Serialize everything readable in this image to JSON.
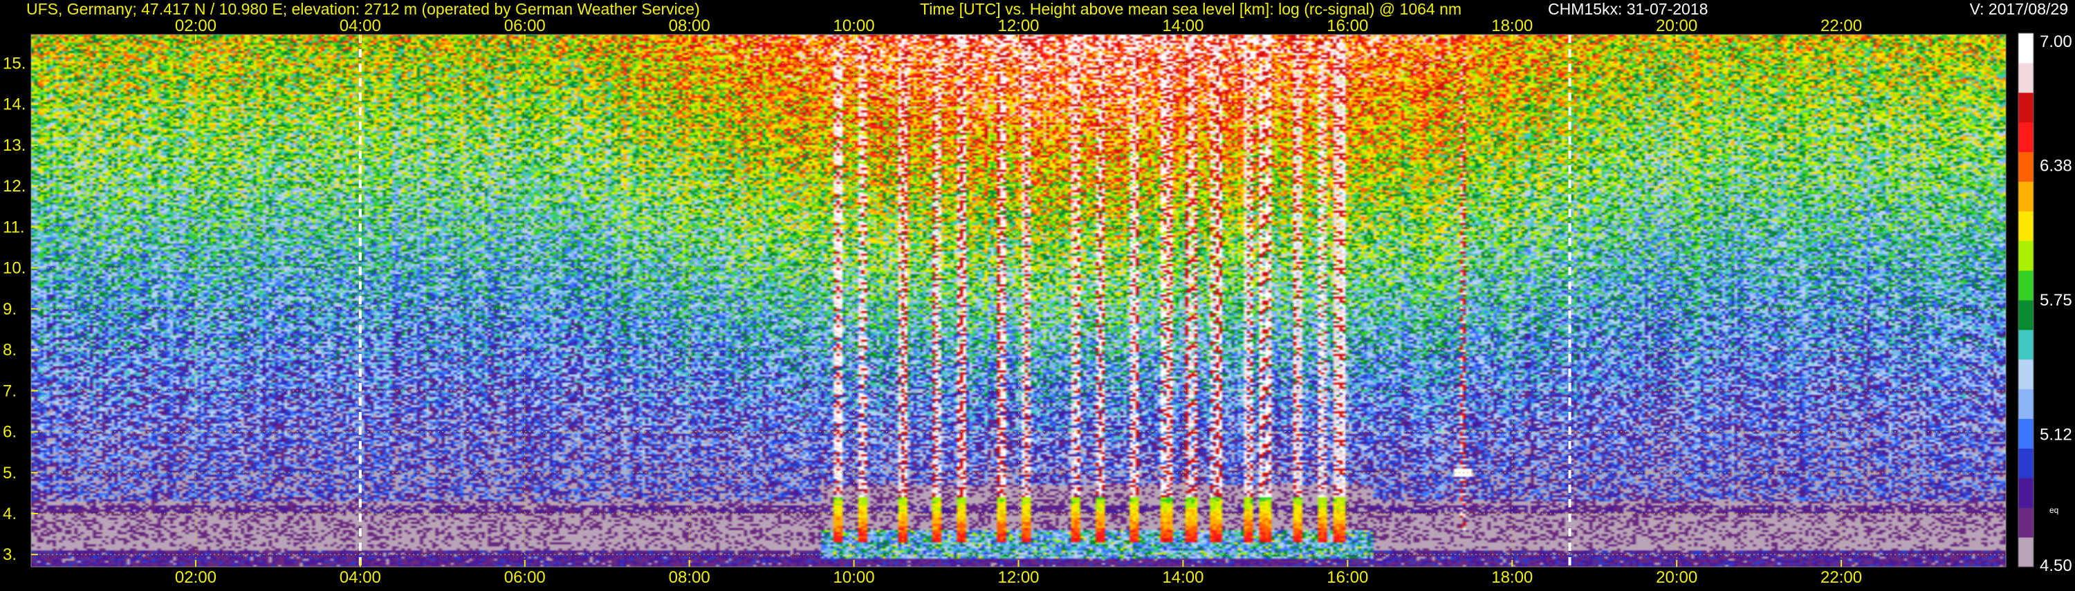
{
  "header": {
    "station": "UFS, Germany; 47.417 N / 10.980 E; elevation: 2712 m  (operated by German Weather Service)",
    "title": "Time [UTC] vs. Height above mean sea level [km]: log (rc-signal) @ 1064 nm",
    "instrument": "CHM15kx: 31-07-2018",
    "version": "V: 2017/08/29",
    "text_color": "#f0f000"
  },
  "chart_data": {
    "type": "heatmap",
    "x_axis": {
      "quantity": "time UTC (hours)",
      "range": [
        0,
        24
      ],
      "tick_values": [
        2,
        4,
        6,
        8,
        10,
        12,
        14,
        16,
        18,
        20,
        22
      ],
      "tick_labels": [
        "02:00",
        "04:00",
        "06:00",
        "08:00",
        "10:00",
        "12:00",
        "14:00",
        "16:00",
        "18:00",
        "20:00",
        "22:00"
      ]
    },
    "y_axis": {
      "quantity": "height above mean sea level (km)",
      "range": [
        2.7,
        15.7
      ],
      "tick_values": [
        3,
        4,
        5,
        6,
        7,
        8,
        9,
        10,
        11,
        12,
        13,
        14,
        15
      ],
      "tick_labels": [
        "3.",
        "4.",
        "5.",
        "6.",
        "7.",
        "8.",
        "9.",
        "10.",
        "11.",
        "12.",
        "13.",
        "14.",
        "15."
      ]
    },
    "grid": true,
    "grid_color": "#d8c000",
    "event_markers_hours": [
      4.0,
      18.7
    ],
    "colorbar": {
      "range": [
        4.5,
        7.0
      ],
      "tick_values": [
        4.5,
        5.12,
        5.75,
        6.38,
        7.0
      ],
      "tick_labels": [
        "4.50",
        "5.12",
        "5.75",
        "6.38",
        "7.00"
      ],
      "sublabel": "eq",
      "colors": [
        "#b8a4b6",
        "#6a2880",
        "#4a1a9a",
        "#2a3cd0",
        "#3c78ff",
        "#8cb4f8",
        "#b8d4f4",
        "#40c8c0",
        "#0a8a30",
        "#34d024",
        "#a8f000",
        "#ffe800",
        "#ffb000",
        "#ff6000",
        "#ff1a1a",
        "#d01010",
        "#f0d8dc",
        "#ffffff"
      ]
    },
    "features": {
      "cloud_columns_hours": [
        9.8,
        10.1,
        10.6,
        11.0,
        11.3,
        11.8,
        12.1,
        12.7,
        13.0,
        13.4,
        13.8,
        14.1,
        14.4,
        14.8,
        15.0,
        15.4,
        15.7,
        15.9
      ],
      "isolated_cloud": {
        "hour": 17.4,
        "height_km": 5.0
      },
      "boundary_layer_top_km": 4.3,
      "convective_layer_span_hours": [
        9.6,
        16.3
      ]
    }
  }
}
